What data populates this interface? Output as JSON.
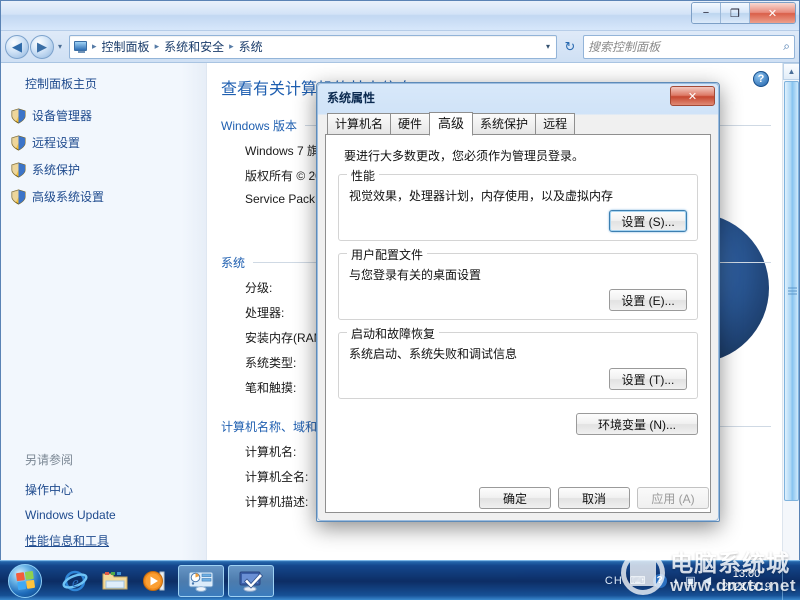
{
  "window": {
    "controls": {
      "minimize": "−",
      "restore": "❐",
      "close": "✕"
    }
  },
  "address_bar": {
    "back_icon": "◀",
    "forward_icon": "▶",
    "history_caret": "▾",
    "breadcrumb": [
      "控制面板",
      "系统和安全",
      "系统"
    ],
    "separator": "▸",
    "dropdown_caret": "▾",
    "refresh_icon": "↻",
    "search_placeholder": "搜索控制面板",
    "search_value": "",
    "search_icon": "⌕"
  },
  "sidebar": {
    "home_label": "控制面板主页",
    "items": [
      {
        "label": "设备管理器"
      },
      {
        "label": "远程设置"
      },
      {
        "label": "系统保护"
      },
      {
        "label": "高级系统设置"
      }
    ],
    "see_also_title": "另请参阅",
    "see_also": [
      {
        "label": "操作中心",
        "hover": false
      },
      {
        "label": "Windows Update",
        "hover": false
      },
      {
        "label": "性能信息和工具",
        "hover": true
      }
    ]
  },
  "content": {
    "help_icon": "?",
    "page_title": "查看有关计算机的基本信息",
    "windows_edition_group": "Windows 版本",
    "edition_lines": [
      "Windows 7 旗舰版",
      "版权所有 © 2009 Microsoft Corporation。保留所有权利。",
      "Service Pack 1"
    ],
    "system_group": "系统",
    "system_rows": [
      {
        "label": "分级:",
        "value": ""
      },
      {
        "label": "处理器:",
        "value": ""
      },
      {
        "label": "安装内存(RAM):",
        "value": ""
      },
      {
        "label": "系统类型:",
        "value": ""
      },
      {
        "label": "笔和触摸:",
        "value": ""
      }
    ],
    "computer_group": "计算机名称、域和工作组设置",
    "computer_rows": [
      {
        "label": "计算机名:",
        "value": ""
      },
      {
        "label": "计算机全名:",
        "value": ""
      },
      {
        "label": "计算机描述:",
        "value": ""
      }
    ],
    "scroll_up_icon": "▲"
  },
  "dialog": {
    "title": "系统属性",
    "close_label": "✕",
    "tabs": [
      {
        "label": "计算机名",
        "active": false
      },
      {
        "label": "硬件",
        "active": false
      },
      {
        "label": "高级",
        "active": true
      },
      {
        "label": "系统保护",
        "active": false
      },
      {
        "label": "远程",
        "active": false
      }
    ],
    "hint": "要进行大多数更改，您必须作为管理员登录。",
    "groups": [
      {
        "legend": "性能",
        "desc": "视觉效果，处理器计划，内存使用，以及虚拟内存",
        "button": "设置 (S)...",
        "focused": true
      },
      {
        "legend": "用户配置文件",
        "desc": "与您登录有关的桌面设置",
        "button": "设置 (E)...",
        "focused": false
      },
      {
        "legend": "启动和故障恢复",
        "desc": "系统启动、系统失败和调试信息",
        "button": "设置 (T)...",
        "focused": false
      }
    ],
    "env_button": "环境变量 (N)...",
    "footer": {
      "ok": "确定",
      "cancel": "取消",
      "apply": "应用 (A)",
      "apply_disabled": true
    }
  },
  "taskbar": {
    "start_tooltip": "开始",
    "quick_launch": [
      {
        "name": "internet-explorer"
      },
      {
        "name": "windows-explorer"
      },
      {
        "name": "windows-media-player"
      }
    ],
    "windows": [
      {
        "name": "控制面板"
      },
      {
        "name": "系统属性"
      }
    ],
    "tray": {
      "ime": "CH",
      "keyboard_icon": "⌨",
      "help_icon": "?",
      "overflow_icon": "▴",
      "network_icon": "▣",
      "volume_icon": "◀",
      "time": "13:00",
      "date": "2021/5/19"
    }
  },
  "watermark": {
    "cn": "电脑系统城",
    "en": "www.dnxtc.net"
  },
  "colors": {
    "accent_blue": "#1f5fb0",
    "link_blue": "#1f4b8e",
    "close_red": "#c64730",
    "taskbar_blue": "#0c2d64"
  }
}
